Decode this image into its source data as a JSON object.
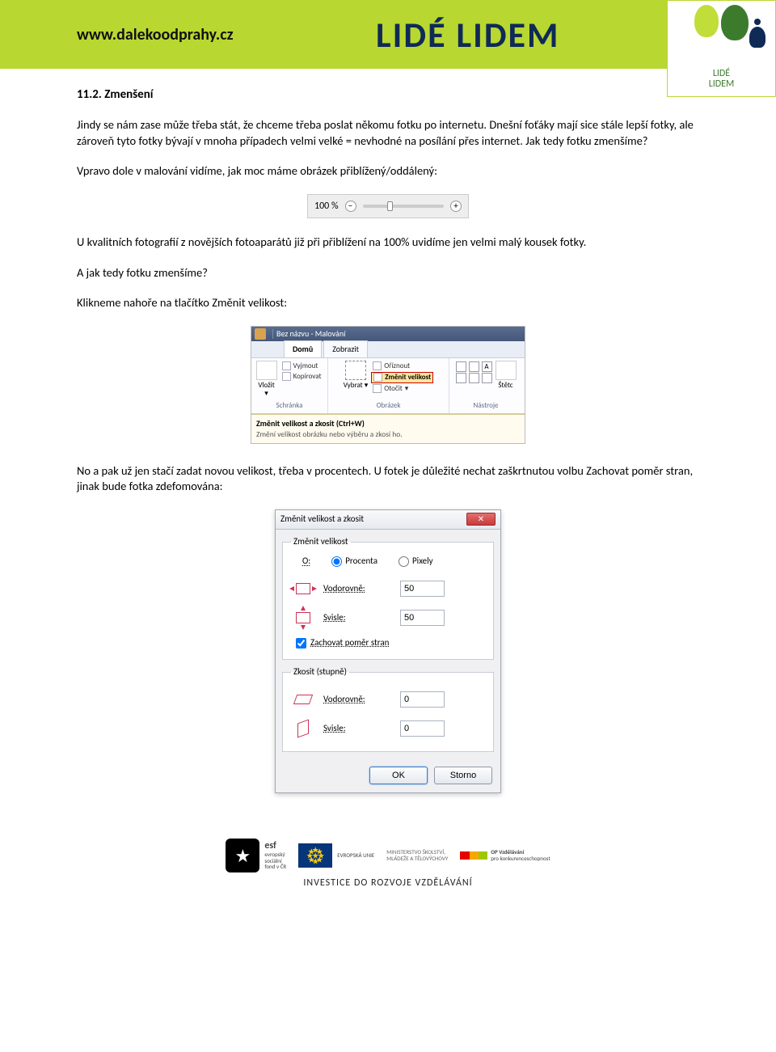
{
  "banner": {
    "url": "www.dalekoodprahy.cz",
    "title": "LIDÉ LIDEM",
    "logo_label_line1": "LIDÉ",
    "logo_label_line2": "LIDEM"
  },
  "heading": "11.2. Zmenšení",
  "paragraphs": {
    "p1": "Jindy se nám zase může třeba stát, že chceme třeba poslat někomu fotku po internetu. Dnešní foťáky mají sice stále lepší fotky, ale zároveň tyto fotky bývají v mnoha případech velmi velké = nevhodné na posílání přes internet. Jak tedy fotku zmenšíme?",
    "p2": "Vpravo dole v malování vidíme, jak moc máme obrázek přiblížený/oddálený:",
    "p3": "U kvalitních fotografií z novějších fotoaparátů již při přiblížení na 100% uvidíme jen velmi malý kousek fotky.",
    "p4": "A jak tedy fotku zmenšíme?",
    "p5": "Klikneme nahoře na tlačítko Změnit velikost:",
    "p6": "No a pak už jen stačí zadat novou velikost, třeba v procentech. U fotek je důležité nechat zaškrtnutou volbu Zachovat poměr stran, jinak bude fotka zdefomována:"
  },
  "zoom": {
    "value": "100 %",
    "minus": "−",
    "plus": "+"
  },
  "ribbon": {
    "app_title": "Bez názvu - Malování",
    "tabs": {
      "home": "Domů",
      "view": "Zobrazit"
    },
    "paste_group": {
      "paste": "Vložit",
      "btns": {
        "cut": "Vyjmout",
        "copy": "Kopírovat"
      },
      "group_label": "Schránka"
    },
    "select_group": {
      "select": "Vybrat",
      "group_label": "Obrázek",
      "btns": {
        "crop": "Oříznout",
        "resize": "Změnit velikost",
        "rotate": "Otočit"
      }
    },
    "tools_group": {
      "group_label": "Nástroje",
      "label": "Štětc"
    },
    "tooltip": {
      "title": "Změnit velikost a zkosit (Ctrl+W)",
      "body": "Změní velikost obrázku nebo výběru a zkosí ho."
    }
  },
  "dialog": {
    "window_title": "Změnit velikost a zkosit",
    "close": "✕",
    "resize_group": {
      "legend": "Změnit velikost",
      "by_label": "O:",
      "radios": {
        "percent": "Procenta",
        "pixels": "Pixely"
      },
      "horizontal_label": "Vodorovně:",
      "horizontal_value": "50",
      "vertical_label": "Svisle:",
      "vertical_value": "50",
      "maintain_label": "Zachovat poměr stran"
    },
    "skew_group": {
      "legend": "Zkosit (stupně)",
      "horizontal_label": "Vodorovně:",
      "horizontal_value": "0",
      "vertical_label": "Svisle:",
      "vertical_value": "0"
    },
    "buttons": {
      "ok": "OK",
      "cancel": "Storno"
    }
  },
  "footer": {
    "esf": "esf",
    "esf_text1": "evropský",
    "esf_text2": "sociální",
    "esf_text3": "fond v ČR",
    "eu_label": "EVROPSKÁ UNIE",
    "msmt1": "MINISTERSTVO ŠKOLSTVÍ,",
    "msmt2": "MLÁDEŽE A TĚLOVÝCHOVY",
    "opvk1": "OP Vzdělávání",
    "opvk2": "pro konkurenceschopnost",
    "tagline": "INVESTICE DO ROZVOJE VZDĚLÁVÁNÍ"
  }
}
